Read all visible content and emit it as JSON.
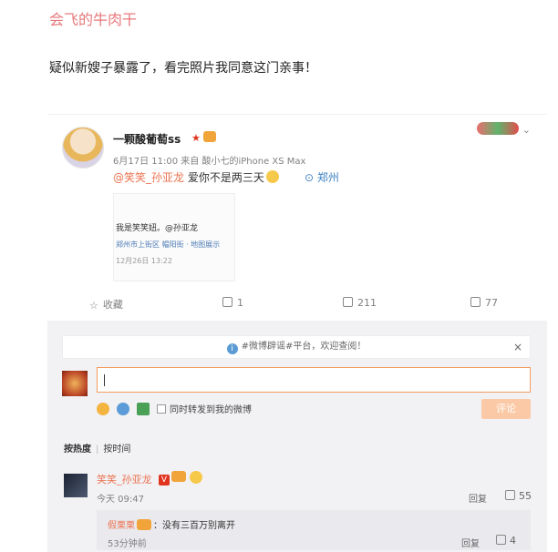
{
  "header": {
    "author": "会飞的牛肉干",
    "caption": "疑似新嫂子暴露了，看完照片我同意这门亲事！"
  },
  "post": {
    "nickname": "一颗酸葡萄ss",
    "meta_time": "6月17日 11:00",
    "meta_from": "来自",
    "meta_source": "酸小七的iPhone XS Max",
    "mention": "@笑笑_孙亚龙",
    "text": "爱你不是两三天",
    "location": "郑州",
    "photo": {
      "line1": "我是笑笑妞。@孙亚龙",
      "line2": "郑州市上街区 帽阳街 · 地图展示",
      "line3": "12月26日 13:22"
    }
  },
  "actions": {
    "favorite_label": "收藏",
    "repost_count": "1",
    "comment_count": "211",
    "like_count": "77"
  },
  "comment_box": {
    "notice": "#微博辟谣#平台，欢迎查阅！",
    "close": "×",
    "repost_option": "同时转发到我的微博",
    "submit_label": "评论"
  },
  "sort": {
    "hot": "按热度",
    "time": "按时间"
  },
  "comments": [
    {
      "name": "笑笑_孙亚龙",
      "time": "今天 09:47",
      "reply_label": "回复",
      "likes": "55"
    }
  ],
  "subreply": {
    "name": "假栗栗",
    "text": "：没有三百万别离开",
    "time": "53分钟前",
    "reply_label": "回复",
    "likes": "4"
  },
  "colors": {
    "accent_orange": "#eb7350",
    "author_pink": "#e8787b",
    "link_blue": "#3e83c5"
  }
}
